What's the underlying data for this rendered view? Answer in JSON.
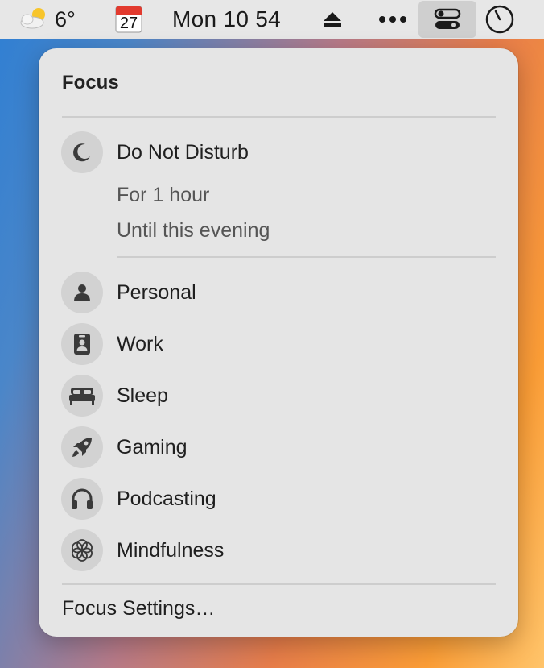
{
  "menubar": {
    "temperature": "6°",
    "calendar_day": "27",
    "clock": "Mon 10 54",
    "icons": [
      "weather-icon",
      "calendar-icon",
      "eject-icon",
      "more-dots-icon",
      "control-center-icon",
      "timer-icon"
    ]
  },
  "focus_menu": {
    "title": "Focus",
    "dnd": {
      "label": "Do Not Disturb",
      "icon": "moon-icon",
      "options": [
        "For 1 hour",
        "Until this evening"
      ]
    },
    "modes": [
      {
        "label": "Personal",
        "icon": "person-icon"
      },
      {
        "label": "Work",
        "icon": "badge-icon"
      },
      {
        "label": "Sleep",
        "icon": "bed-icon"
      },
      {
        "label": "Gaming",
        "icon": "rocket-icon"
      },
      {
        "label": "Podcasting",
        "icon": "headphones-icon"
      },
      {
        "label": "Mindfulness",
        "icon": "flower-icon"
      }
    ],
    "settings_label": "Focus Settings…"
  },
  "colors": {
    "panel_bg": "#e5e5e5",
    "icon_circle": "#d2d2d2",
    "menubar_bg": "#e7e7e7",
    "icon_glyph": "#3a3a3a"
  }
}
